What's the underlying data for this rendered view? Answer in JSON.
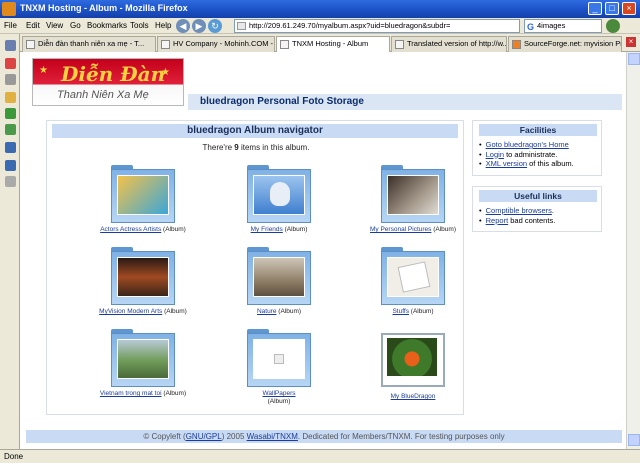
{
  "window": {
    "title": "TNXM Hosting - Album - Mozilla Firefox",
    "min": "_",
    "max": "□",
    "close": "×"
  },
  "menu": {
    "items": [
      "File",
      "Edit",
      "View",
      "Go",
      "Bookmarks",
      "Tools",
      "Help"
    ]
  },
  "toolbar": {
    "url": "http://209.61.249.70/myalbum.aspx?uid=bluedragon&subdr=",
    "search_engine": "G",
    "search_placeholder": "4images"
  },
  "tabs": [
    {
      "label": "Diễn đàn thanh niên xa mẹ - T..."
    },
    {
      "label": "HV Company - Mohinh.COM - ..."
    },
    {
      "label": "TNXM Hosting - Album"
    },
    {
      "label": "Translated version of http://w..."
    },
    {
      "label": "SourceForge.net: myvision Pr..."
    }
  ],
  "logo": {
    "line1": "Diễn Đàn",
    "line2": "Thanh Niên Xa Mẹ"
  },
  "header": {
    "title": "bluedragon Personal Foto Storage"
  },
  "navigator": {
    "title": "bluedragon Album navigator",
    "count_prefix": "There're ",
    "count": "9",
    "count_suffix": " items in this album.",
    "albums": [
      {
        "link": "Actors Actress Artists",
        "suffix": " (Album)",
        "thumb_color": "#e8a43a"
      },
      {
        "link": "My Friends",
        "suffix": " (Album)",
        "thumb_color": "#4a88d0"
      },
      {
        "link": "My Personal Pictures",
        "suffix": " (Album)",
        "thumb_color": "#7b6a5e"
      },
      {
        "link": "MyVision Modern Arts",
        "suffix": " (Album)",
        "thumb_color": "#8a3a22"
      },
      {
        "link": "Nature",
        "suffix": " (Album)",
        "thumb_color": "#b09d86"
      },
      {
        "link": "Stuffs",
        "suffix": " (Album)",
        "thumb_color": "#e9e4dd"
      },
      {
        "link": "Vietnam trong mat toi",
        "suffix": " (Album)",
        "thumb_color": "#6f9b58"
      },
      {
        "link": "WallPapers",
        "suffix": " (Album)",
        "thumb_color": "#ffffff"
      },
      {
        "link": "My BlueDragon",
        "suffix": "",
        "thumb_color": "#3f7a2a"
      }
    ]
  },
  "facilities": {
    "title": "Facilities",
    "items": [
      {
        "link": "Goto bluedragon's Home",
        "rest": ""
      },
      {
        "link": "Login",
        "rest": " to administrate."
      },
      {
        "link": "XML version",
        "rest": " of this album."
      }
    ]
  },
  "useful_links": {
    "title": "Useful links",
    "items": [
      {
        "link": "Comptible browsers",
        "rest": "."
      },
      {
        "link": "Report",
        "rest": " bad contents."
      }
    ]
  },
  "footer": {
    "prefix": "© Copyleft (",
    "gpl": "GNU/GPL",
    "middle": ") 2005 ",
    "author": "Wasabi/TNXM",
    "suffix": ". Dedicated for Members/TNXM. For testing purposes only"
  },
  "status": {
    "text": "Done"
  }
}
